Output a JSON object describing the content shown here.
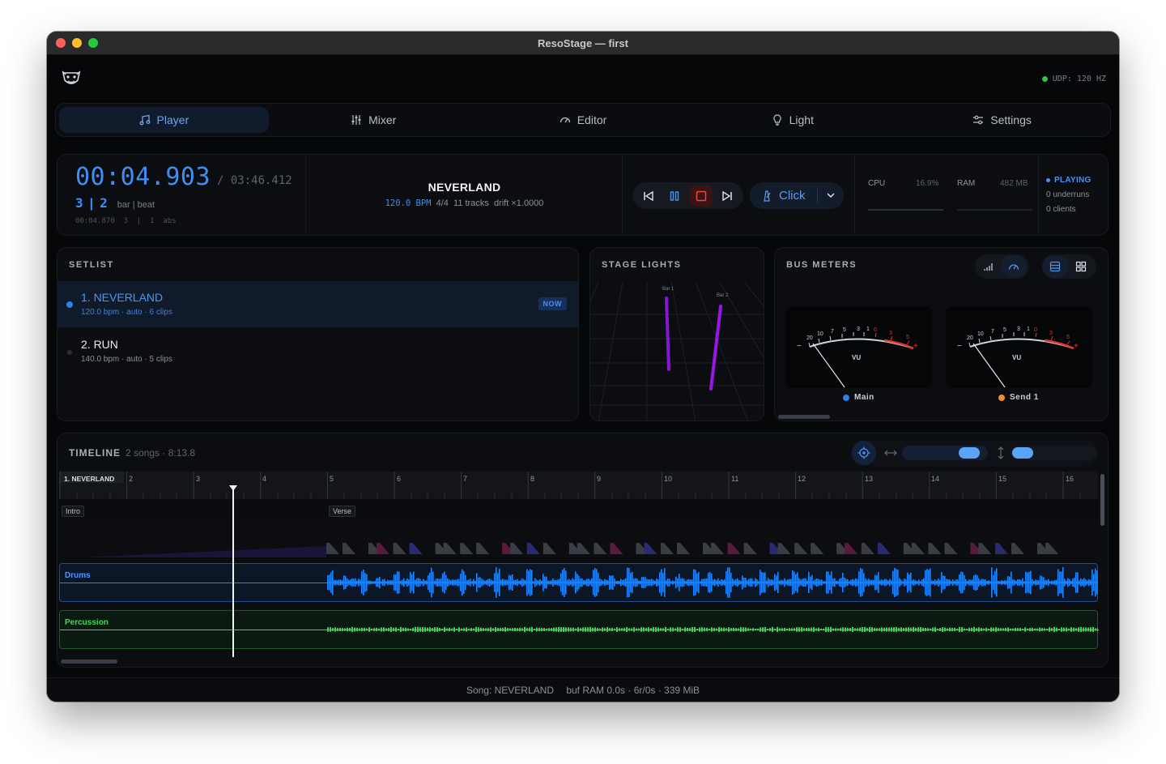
{
  "window": {
    "title": "ResoStage — first"
  },
  "header": {
    "udp_status": "UDP: 120 HZ",
    "logo_icon": "theater-mask-icon"
  },
  "tabs": [
    {
      "label": "Player",
      "icon": "music-note-icon",
      "active": true
    },
    {
      "label": "Mixer",
      "icon": "sliders-icon",
      "active": false
    },
    {
      "label": "Editor",
      "icon": "gauge-icon",
      "active": false
    },
    {
      "label": "Light",
      "icon": "lightbulb-icon",
      "active": false
    },
    {
      "label": "Settings",
      "icon": "settings-icon",
      "active": false
    }
  ],
  "transport": {
    "time": "00:04.903",
    "total": "/ 03:46.412",
    "bar": "3",
    "separator": "|",
    "beat": "2",
    "barbeat_label": "bar | beat",
    "abs_line": "00:04.870  3  |  1  abs",
    "song_title": "NEVERLAND",
    "bpm": "120.0 BPM",
    "signature": "4/4",
    "tracks": "11 tracks",
    "drift": "drift ×1.0000",
    "click_label": "Click"
  },
  "stats": {
    "cpu_label": "CPU",
    "cpu_value": "16.9%",
    "ram_label": "RAM",
    "ram_value": "482 MB",
    "state": "PLAYING",
    "underruns": "0 underruns",
    "clients": "0 clients"
  },
  "setlist": {
    "title": "SETLIST",
    "items": [
      {
        "title": "1. NEVERLAND",
        "meta": "120.0 bpm · auto · 6 clips",
        "badge": "NOW",
        "active": true
      },
      {
        "title": "2. RUN",
        "meta": "140.0 bpm · auto · 5 clips",
        "badge": "",
        "active": false
      }
    ]
  },
  "stage_lights": {
    "title": "STAGE LIGHTS",
    "fixtures": [
      "Bar 1",
      "Bar 2"
    ]
  },
  "bus_meters": {
    "title": "BUS METERS",
    "meters": [
      {
        "name": "Main",
        "color": "#2f7fe8",
        "scale": [
          "20",
          "10",
          "7",
          "5",
          "3",
          "1",
          "0",
          "1",
          "3",
          "5"
        ],
        "unit": "VU"
      },
      {
        "name": "Send 1",
        "color": "#f08a2a",
        "scale": [
          "20",
          "10",
          "7",
          "5",
          "3",
          "1",
          "0",
          "1",
          "3",
          "5"
        ],
        "unit": "VU"
      }
    ]
  },
  "timeline": {
    "title": "TIMELINE",
    "subtitle": "2 songs · 8:13.8",
    "song_label": "1. NEVERLAND",
    "bars": [
      "2",
      "3",
      "4",
      "5",
      "6",
      "7",
      "8",
      "9",
      "10",
      "11",
      "12",
      "13",
      "14",
      "15",
      "16"
    ],
    "markers": [
      "Intro",
      "Verse"
    ],
    "tracks": [
      {
        "name": "Drums",
        "color": "#1f86ff"
      },
      {
        "name": "Percussion",
        "color": "#3fd45a"
      }
    ]
  },
  "statusbar": {
    "song": "Song: NEVERLAND",
    "buffer": "buf RAM 0.0s · 6r/0s · 339 MiB"
  }
}
